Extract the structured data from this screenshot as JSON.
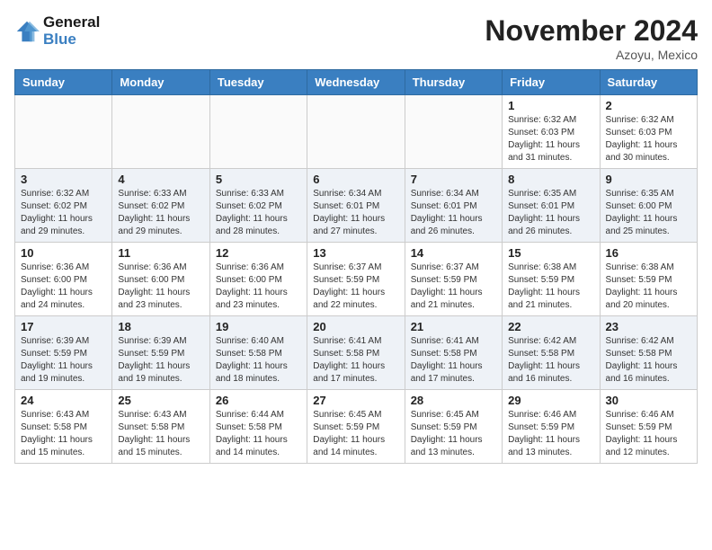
{
  "header": {
    "logo_line1": "General",
    "logo_line2": "Blue",
    "month_title": "November 2024",
    "location": "Azoyu, Mexico"
  },
  "weekdays": [
    "Sunday",
    "Monday",
    "Tuesday",
    "Wednesday",
    "Thursday",
    "Friday",
    "Saturday"
  ],
  "weeks": [
    [
      {
        "day": "",
        "info": ""
      },
      {
        "day": "",
        "info": ""
      },
      {
        "day": "",
        "info": ""
      },
      {
        "day": "",
        "info": ""
      },
      {
        "day": "",
        "info": ""
      },
      {
        "day": "1",
        "info": "Sunrise: 6:32 AM\nSunset: 6:03 PM\nDaylight: 11 hours and 31 minutes."
      },
      {
        "day": "2",
        "info": "Sunrise: 6:32 AM\nSunset: 6:03 PM\nDaylight: 11 hours and 30 minutes."
      }
    ],
    [
      {
        "day": "3",
        "info": "Sunrise: 6:32 AM\nSunset: 6:02 PM\nDaylight: 11 hours and 29 minutes."
      },
      {
        "day": "4",
        "info": "Sunrise: 6:33 AM\nSunset: 6:02 PM\nDaylight: 11 hours and 29 minutes."
      },
      {
        "day": "5",
        "info": "Sunrise: 6:33 AM\nSunset: 6:02 PM\nDaylight: 11 hours and 28 minutes."
      },
      {
        "day": "6",
        "info": "Sunrise: 6:34 AM\nSunset: 6:01 PM\nDaylight: 11 hours and 27 minutes."
      },
      {
        "day": "7",
        "info": "Sunrise: 6:34 AM\nSunset: 6:01 PM\nDaylight: 11 hours and 26 minutes."
      },
      {
        "day": "8",
        "info": "Sunrise: 6:35 AM\nSunset: 6:01 PM\nDaylight: 11 hours and 26 minutes."
      },
      {
        "day": "9",
        "info": "Sunrise: 6:35 AM\nSunset: 6:00 PM\nDaylight: 11 hours and 25 minutes."
      }
    ],
    [
      {
        "day": "10",
        "info": "Sunrise: 6:36 AM\nSunset: 6:00 PM\nDaylight: 11 hours and 24 minutes."
      },
      {
        "day": "11",
        "info": "Sunrise: 6:36 AM\nSunset: 6:00 PM\nDaylight: 11 hours and 23 minutes."
      },
      {
        "day": "12",
        "info": "Sunrise: 6:36 AM\nSunset: 6:00 PM\nDaylight: 11 hours and 23 minutes."
      },
      {
        "day": "13",
        "info": "Sunrise: 6:37 AM\nSunset: 5:59 PM\nDaylight: 11 hours and 22 minutes."
      },
      {
        "day": "14",
        "info": "Sunrise: 6:37 AM\nSunset: 5:59 PM\nDaylight: 11 hours and 21 minutes."
      },
      {
        "day": "15",
        "info": "Sunrise: 6:38 AM\nSunset: 5:59 PM\nDaylight: 11 hours and 21 minutes."
      },
      {
        "day": "16",
        "info": "Sunrise: 6:38 AM\nSunset: 5:59 PM\nDaylight: 11 hours and 20 minutes."
      }
    ],
    [
      {
        "day": "17",
        "info": "Sunrise: 6:39 AM\nSunset: 5:59 PM\nDaylight: 11 hours and 19 minutes."
      },
      {
        "day": "18",
        "info": "Sunrise: 6:39 AM\nSunset: 5:59 PM\nDaylight: 11 hours and 19 minutes."
      },
      {
        "day": "19",
        "info": "Sunrise: 6:40 AM\nSunset: 5:58 PM\nDaylight: 11 hours and 18 minutes."
      },
      {
        "day": "20",
        "info": "Sunrise: 6:41 AM\nSunset: 5:58 PM\nDaylight: 11 hours and 17 minutes."
      },
      {
        "day": "21",
        "info": "Sunrise: 6:41 AM\nSunset: 5:58 PM\nDaylight: 11 hours and 17 minutes."
      },
      {
        "day": "22",
        "info": "Sunrise: 6:42 AM\nSunset: 5:58 PM\nDaylight: 11 hours and 16 minutes."
      },
      {
        "day": "23",
        "info": "Sunrise: 6:42 AM\nSunset: 5:58 PM\nDaylight: 11 hours and 16 minutes."
      }
    ],
    [
      {
        "day": "24",
        "info": "Sunrise: 6:43 AM\nSunset: 5:58 PM\nDaylight: 11 hours and 15 minutes."
      },
      {
        "day": "25",
        "info": "Sunrise: 6:43 AM\nSunset: 5:58 PM\nDaylight: 11 hours and 15 minutes."
      },
      {
        "day": "26",
        "info": "Sunrise: 6:44 AM\nSunset: 5:58 PM\nDaylight: 11 hours and 14 minutes."
      },
      {
        "day": "27",
        "info": "Sunrise: 6:45 AM\nSunset: 5:59 PM\nDaylight: 11 hours and 14 minutes."
      },
      {
        "day": "28",
        "info": "Sunrise: 6:45 AM\nSunset: 5:59 PM\nDaylight: 11 hours and 13 minutes."
      },
      {
        "day": "29",
        "info": "Sunrise: 6:46 AM\nSunset: 5:59 PM\nDaylight: 11 hours and 13 minutes."
      },
      {
        "day": "30",
        "info": "Sunrise: 6:46 AM\nSunset: 5:59 PM\nDaylight: 11 hours and 12 minutes."
      }
    ]
  ]
}
